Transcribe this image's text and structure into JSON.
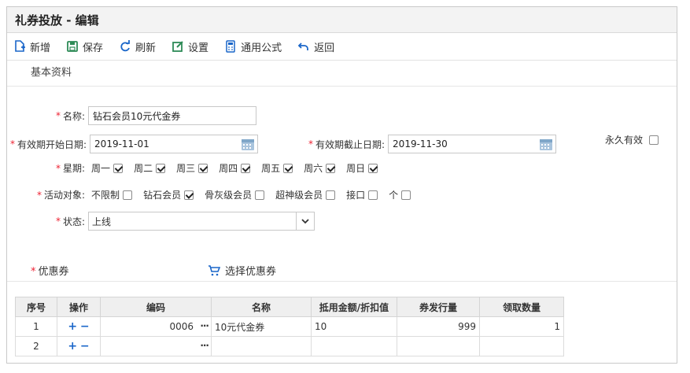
{
  "window": {
    "title": "礼券投放 - 编辑"
  },
  "toolbar": {
    "new_label": "新增",
    "save_label": "保存",
    "refresh_label": "刷新",
    "settings_label": "设置",
    "formula_label": "通用公式",
    "back_label": "返回"
  },
  "section": {
    "basic_title": "基本资料"
  },
  "form": {
    "name_label": "名称:",
    "name_value": "钻石会员10元代金券",
    "start_label": "有效期开始日期:",
    "start_value": "2019-11-01",
    "end_label": "有效期截止日期:",
    "end_value": "2019-11-30",
    "permanent_label": "永久有效",
    "permanent_checked": false,
    "week_label": "星期:",
    "days": [
      {
        "label": "周一",
        "checked": true
      },
      {
        "label": "周二",
        "checked": true
      },
      {
        "label": "周三",
        "checked": true
      },
      {
        "label": "周四",
        "checked": true
      },
      {
        "label": "周五",
        "checked": true
      },
      {
        "label": "周六",
        "checked": true
      },
      {
        "label": "周日",
        "checked": true
      }
    ],
    "target_label": "活动对象:",
    "targets": [
      {
        "label": "不限制",
        "checked": false
      },
      {
        "label": "钻石会员",
        "checked": true
      },
      {
        "label": "骨灰级会员",
        "checked": false
      },
      {
        "label": "超神级会员",
        "checked": false
      },
      {
        "label": "接口",
        "checked": false
      },
      {
        "label": "个",
        "checked": false
      }
    ],
    "status_label": "状态:",
    "status_value": "上线"
  },
  "coupons": {
    "title": "优惠券",
    "select_label": "选择优惠券",
    "columns": [
      "序号",
      "操作",
      "编码",
      "名称",
      "抵用金额/折扣值",
      "券发行量",
      "领取数量"
    ],
    "rows": [
      {
        "seq": "1",
        "code": "0006",
        "name": "10元代金券",
        "amount": "10",
        "issue": "999",
        "received": "1"
      },
      {
        "seq": "2",
        "code": "",
        "name": "",
        "amount": "",
        "issue": "",
        "received": ""
      }
    ]
  },
  "colors": {
    "accent": "#2e8b57",
    "required": "#e23333",
    "link": "#1a66c9"
  }
}
